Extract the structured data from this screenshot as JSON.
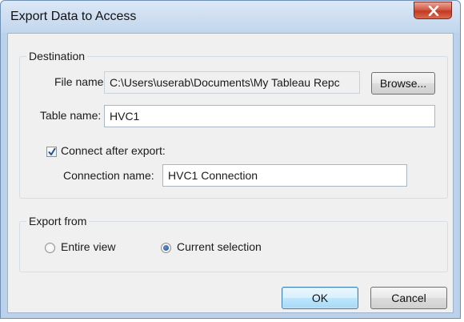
{
  "window": {
    "title": "Export Data to Access"
  },
  "destination": {
    "group_label": "Destination",
    "file_name_label": "File name:",
    "file_name_value": "C:\\Users\\userab\\Documents\\My Tableau Repc",
    "browse_label": "Browse...",
    "table_name_label": "Table name:",
    "table_name_value": "HVC1",
    "connect_label": "Connect after export:",
    "connect_checked": true,
    "connection_name_label": "Connection name:",
    "connection_name_value": "HVC1 Connection"
  },
  "export_from": {
    "group_label": "Export from",
    "options": [
      {
        "label": "Entire view",
        "selected": false
      },
      {
        "label": "Current selection",
        "selected": true
      }
    ]
  },
  "buttons": {
    "ok": "OK",
    "cancel": "Cancel"
  },
  "colors": {
    "close_button": "#c23a22",
    "default_button_border": "#3c7fb1",
    "check_mark": "#2b4f8a"
  }
}
